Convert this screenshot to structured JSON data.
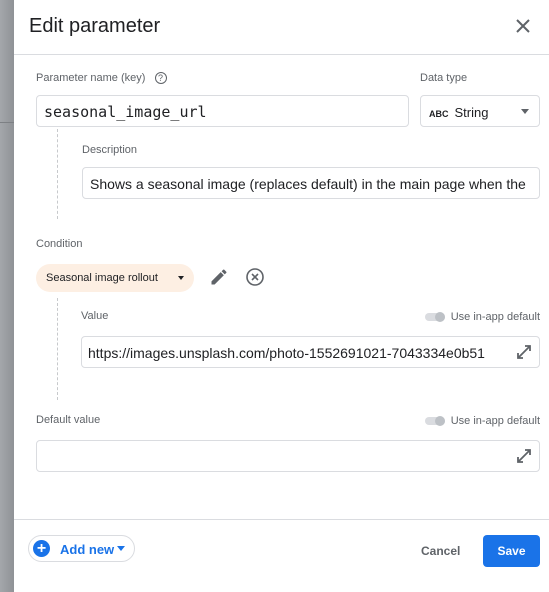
{
  "dialog": {
    "title": "Edit parameter",
    "close_icon": "close-icon"
  },
  "param": {
    "label": "Parameter name (key)",
    "value": "seasonal_image_url",
    "help_icon": "help-circle-icon"
  },
  "datatype": {
    "label": "Data type",
    "badge": "ABC",
    "value": "String"
  },
  "description": {
    "label": "Description",
    "value": "Shows a seasonal image (replaces default) in the main page when the"
  },
  "condition": {
    "label": "Condition",
    "chip": "Seasonal image rollout",
    "chip_color": "#fdefe3",
    "value_label": "Value",
    "toggle_label": "Use in-app default",
    "value": "https://images.unsplash.com/photo-1552691021-7043334e0b51"
  },
  "default": {
    "label": "Default value",
    "toggle_label": "Use in-app default",
    "value": ""
  },
  "footer": {
    "add_new": "Add new",
    "cancel": "Cancel",
    "save": "Save",
    "accent": "#1a73e8"
  }
}
